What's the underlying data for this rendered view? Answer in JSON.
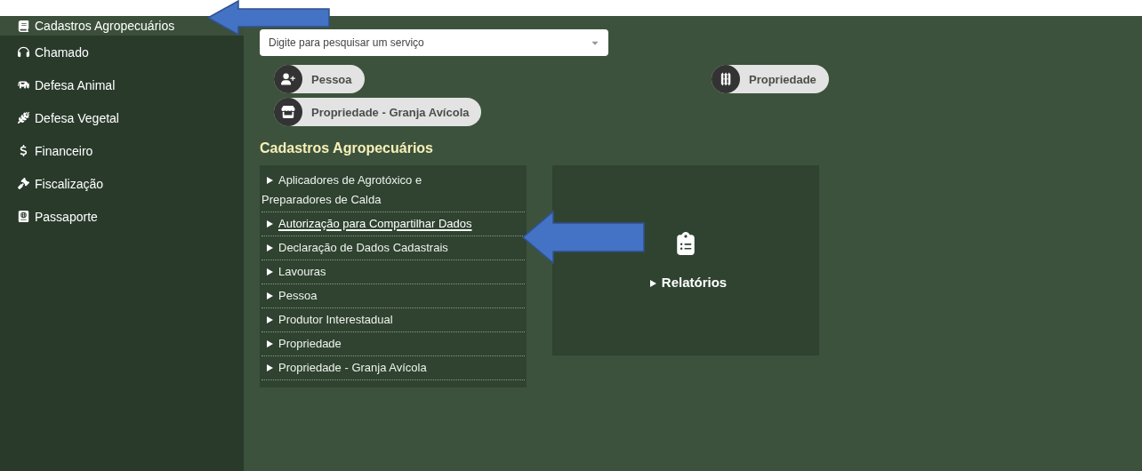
{
  "sidebar": {
    "items": [
      {
        "label": "Cadastros Agropecuários",
        "selected": true
      },
      {
        "label": "Chamado",
        "selected": false
      },
      {
        "label": "Defesa Animal",
        "selected": false
      },
      {
        "label": "Defesa Vegetal",
        "selected": false
      },
      {
        "label": "Financeiro",
        "selected": false
      },
      {
        "label": "Fiscalização",
        "selected": false
      },
      {
        "label": "Passaporte",
        "selected": false
      }
    ]
  },
  "search": {
    "placeholder": "Digite para pesquisar um serviço"
  },
  "shortcuts": [
    {
      "label": "Pessoa"
    },
    {
      "label": "Propriedade"
    },
    {
      "label": "Propriedade - Granja Avícola"
    }
  ],
  "section_title": "Cadastros Agropecuários",
  "menu": {
    "items": [
      {
        "label": "Aplicadores de Agrotóxico e Preparadores de Calda",
        "selected": false
      },
      {
        "label": "Autorização para Compartilhar Dados",
        "selected": true
      },
      {
        "label": "Declaração de Dados Cadastrais",
        "selected": false
      },
      {
        "label": "Lavouras",
        "selected": false
      },
      {
        "label": "Pessoa",
        "selected": false
      },
      {
        "label": "Produtor Interestadual",
        "selected": false
      },
      {
        "label": "Propriedade",
        "selected": false
      },
      {
        "label": "Propriedade - Granja Avícola",
        "selected": false
      }
    ]
  },
  "reports_card": {
    "label": "Relatórios"
  }
}
